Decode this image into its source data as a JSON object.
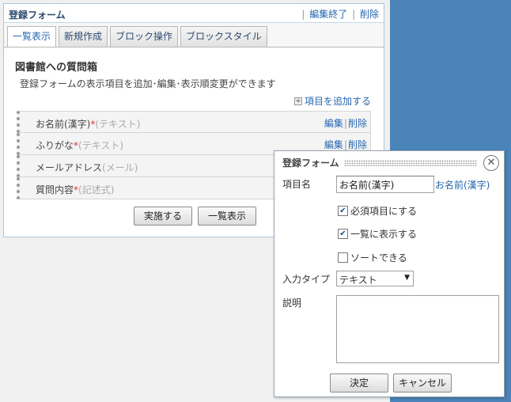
{
  "panel": {
    "title": "登録フォーム",
    "edit_end_label": "編集終了",
    "delete_label": "削除",
    "tabs": [
      {
        "label": "一覧表示"
      },
      {
        "label": "新規作成"
      },
      {
        "label": "ブロック操作"
      },
      {
        "label": "ブロックスタイル"
      }
    ],
    "active_tab": "一覧表示"
  },
  "content": {
    "form_title": "図書館への質問箱",
    "form_desc": "登録フォームの表示項目を追加･編集･表示順変更ができます",
    "add_item_label": "項目を追加する",
    "fields": [
      {
        "name": "お名前(漢字)",
        "required": "*",
        "type": "(テキスト)",
        "edit": "編集",
        "delete": "削除"
      },
      {
        "name": "ふりがな",
        "required": "*",
        "type": "(テキスト)",
        "edit": "編集",
        "delete": "削除"
      },
      {
        "name": "メールアドレス",
        "required": "",
        "type": "(メール)",
        "edit": "",
        "delete": ""
      },
      {
        "name": "質問内容",
        "required": "*",
        "type": "(記述式)",
        "edit": "",
        "delete": ""
      }
    ],
    "execute_button": "実施する",
    "list_button": "一覧表示"
  },
  "dialog": {
    "title": "登録フォーム",
    "item_name_label": "項目名",
    "item_name_value": "お名前(漢字)",
    "item_name_preview": "お名前(漢字)",
    "required_label": "必須項目にする",
    "required_checked": true,
    "show_in_list_label": "一覧に表示する",
    "show_in_list_checked": true,
    "sortable_label": "ソートできる",
    "sortable_checked": false,
    "input_type_label": "入力タイプ",
    "input_type_value": "テキスト",
    "description_label": "説明",
    "description_value": "",
    "ok_button": "決定",
    "cancel_button": "キャンセル"
  }
}
